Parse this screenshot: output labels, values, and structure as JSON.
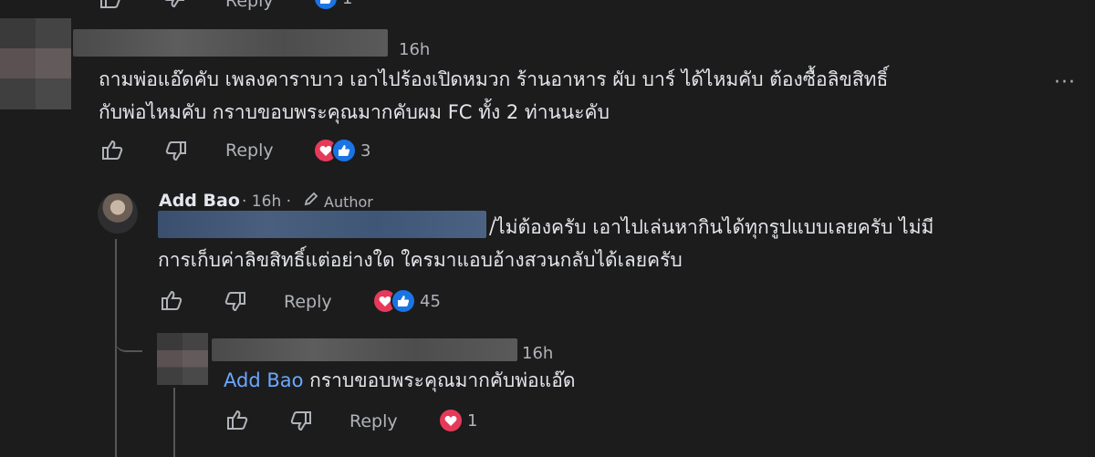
{
  "top_actions": {
    "reply": "Reply",
    "count": "1"
  },
  "comment1": {
    "time": "16h",
    "line1": "ถามพ่อแอ๊ดคับ เพลงคาราบาว เอาไปร้องเปิดหมวก ร้านอาหาร ผับ บาร์ ได้ไหมคับ ต้องซื้อลิขสิทธิ์",
    "line2": "กับพ่อไหมคับ กราบขอบพระคุณมากคับผม FC ทั้ง 2 ท่านนะคับ",
    "more": "···",
    "reply": "Reply",
    "reaction_count": "3"
  },
  "reply1": {
    "name": "Add Bao",
    "time": "· 16h ·",
    "badge": "Author",
    "line1": "/ไม่ต้องครับ เอาไปเล่นหากินได้ทุกรูปแบบเลยครับ ไม่มี",
    "line2": "การเก็บค่าลิขสิทธิ์แต่อย่างใด ใครมาแอบอ้างสวนกลับได้เลยครับ",
    "reply": "Reply",
    "reaction_count": "45"
  },
  "reply2": {
    "time": "16h",
    "mention": "Add Bao",
    "text": " กราบขอบพระคุณมากคับพ่อแอ๊ด",
    "reply": "Reply",
    "reaction_count": "1"
  },
  "colors": {
    "background": "#1c1c1d",
    "text": "#e4e6eb",
    "muted": "#b0b3b8",
    "mention": "#6aa8ff",
    "heart": "#e63a5a",
    "like": "#1b74e4"
  }
}
